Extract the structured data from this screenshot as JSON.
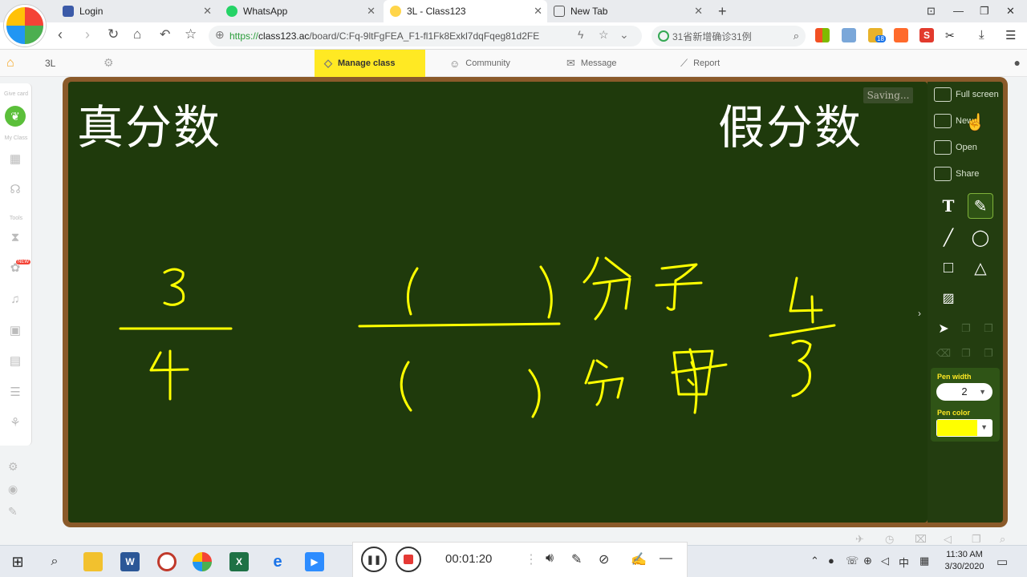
{
  "browser": {
    "tabs": [
      {
        "label": "Login",
        "active": false
      },
      {
        "label": "WhatsApp",
        "active": false
      },
      {
        "label": "3L - Class123",
        "active": true
      },
      {
        "label": "New Tab",
        "active": false
      }
    ],
    "url_scheme": "https://",
    "url_host": "class123.ac",
    "url_path": "/board/C:Fq-9ltFgFEA_F1-fl1Fk8Exkl7dqFqeg81d2FE",
    "search_text": "31省新增确诊31例",
    "ext_badge": "18"
  },
  "app": {
    "class_name": "3L",
    "nav": {
      "manage_class": "Manage class",
      "community": "Community",
      "message": "Message",
      "report": "Report"
    },
    "sidebar": {
      "give_card": "Give card",
      "my_class": "My Class",
      "tools": "Tools",
      "new_badge": "NEW"
    }
  },
  "board": {
    "title_left": "真分数",
    "title_right": "假分数",
    "status": "Saving..."
  },
  "toolpanel": {
    "full_screen": "Full screen",
    "new": "New",
    "open": "Open",
    "share": "Share",
    "pen_width_label": "Pen width",
    "pen_width_value": "2",
    "pen_color_label": "Pen color",
    "pen_color": "#ffff00"
  },
  "recorder": {
    "timer": "00:01:20"
  },
  "taskbar": {
    "time": "11:30 AM",
    "date": "3/30/2020",
    "ime": "中"
  }
}
